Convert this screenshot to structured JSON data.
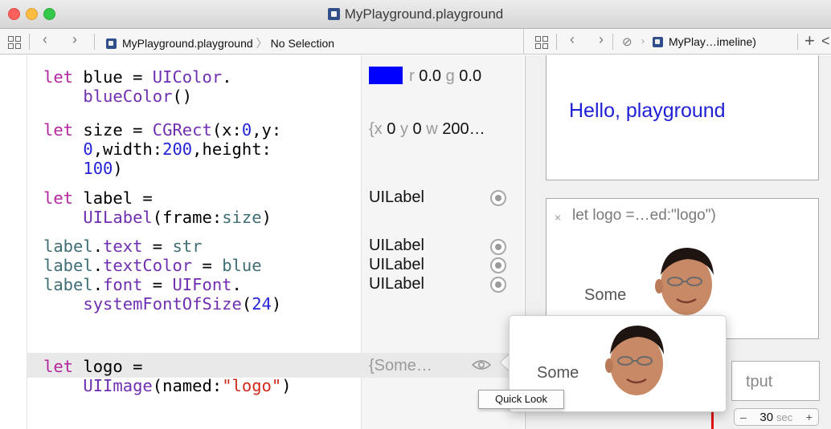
{
  "window": {
    "title": "MyPlayground.playground"
  },
  "jumpbar_left": {
    "file": "MyPlayground.playground",
    "selection": "No Selection"
  },
  "jumpbar_right": {
    "file": "MyPlay…imeline)",
    "add": "+",
    "more": "<"
  },
  "code_lines": [
    "let blue = UIColor.",
    "    blueColor()",
    "let size = CGRect(x:0,y:",
    "    0,width:200,height:",
    "    100)",
    "let label =",
    "    UILabel(frame:size)",
    "label.text = str",
    "label.textColor = blue",
    "label.font = UIFont.",
    "    systemFontOfSize(24)",
    "let logo =",
    "    UIImage(named:\"logo\")"
  ],
  "results": {
    "color": {
      "r_label": "r",
      "r_val": "0.0",
      "g_label": "g",
      "g_val": "0.0",
      "swatch": "#0000ff"
    },
    "rect": {
      "x_label": "{x",
      "x_val": "0",
      "y_label": "y",
      "y_val": "0",
      "w_label": "w",
      "w_val": "200…"
    },
    "label1": "UILabel",
    "label2": "UILabel",
    "label3": "UILabel",
    "label4": "UILabel",
    "logo": "{Some…"
  },
  "timeline": {
    "card1_text": "Hello, playground",
    "card2_title": "let logo =…ed:\"logo\")",
    "card2_close": "×",
    "card2_value": "Some",
    "output_fragment": "tput",
    "stepper": {
      "minus": "–",
      "value": "30",
      "unit": "sec",
      "plus": "+"
    }
  },
  "quicklook": {
    "value": "Some",
    "tooltip": "Quick Look"
  },
  "colors": {
    "keyword": "#b3279f",
    "type": "#6f2fb0",
    "number": "#2424d6",
    "string": "#d12a1c",
    "identifier": "#3f6e74"
  }
}
